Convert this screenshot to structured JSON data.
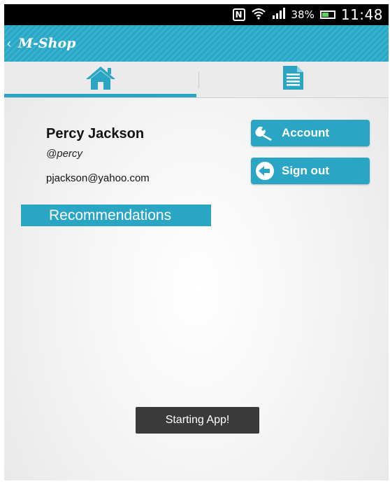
{
  "status_bar": {
    "nfc_label": "N",
    "battery_percent": "38%",
    "time": "11:48",
    "icons": [
      "nfc-icon",
      "wifi-icon",
      "signal-icon",
      "battery-icon"
    ]
  },
  "action_bar": {
    "back_glyph": "‹",
    "title": "M-Shop"
  },
  "tabs": [
    {
      "icon": "home-icon",
      "active": true
    },
    {
      "icon": "document-list-icon",
      "active": false
    }
  ],
  "profile": {
    "name": "Percy Jackson",
    "handle": "@percy",
    "email": "pjackson@yahoo.com"
  },
  "buttons": {
    "account_label": "Account",
    "account_icon": "wrench-icon",
    "signout_label": "Sign out",
    "signout_icon": "back-arrow-circle-icon"
  },
  "recommendations_label": "Recommendations",
  "toast": "Starting App!",
  "colors": {
    "accent": "#2aa6c4",
    "toast_bg": "#3a3a3a",
    "status_bar_bg": "#000000"
  }
}
